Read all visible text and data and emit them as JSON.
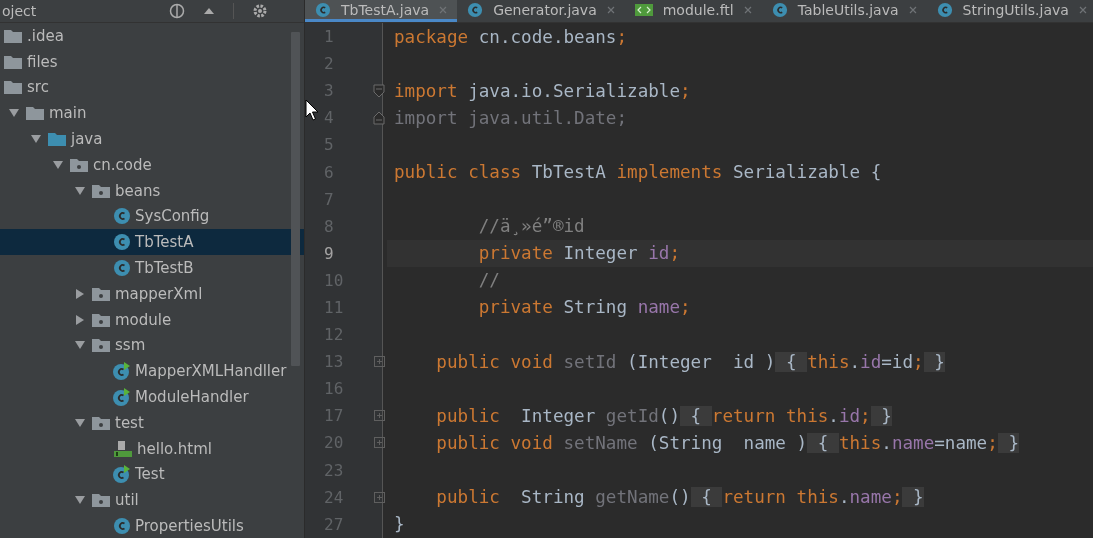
{
  "project_panel": {
    "title": "oject",
    "tree": [
      {
        "label": ".idea",
        "kind": "folder",
        "selected": false
      },
      {
        "label": "files",
        "kind": "folder",
        "selected": false
      },
      {
        "label": "src",
        "kind": "folder",
        "selected": false,
        "children": [
          {
            "label": "main",
            "kind": "folder",
            "expanded": true,
            "selected": false,
            "children": [
              {
                "label": "java",
                "kind": "source",
                "expanded": true,
                "selected": false,
                "children": [
                  {
                    "label": "cn.code",
                    "kind": "package",
                    "expanded": true,
                    "selected": false,
                    "children": [
                      {
                        "label": "beans",
                        "kind": "package",
                        "expanded": true,
                        "selected": false,
                        "children": [
                          {
                            "label": "SysConfig",
                            "kind": "class",
                            "selected": false
                          },
                          {
                            "label": "TbTestA",
                            "kind": "class",
                            "selected": true
                          },
                          {
                            "label": "TbTestB",
                            "kind": "class",
                            "selected": false
                          }
                        ]
                      },
                      {
                        "label": "mapperXml",
                        "kind": "package",
                        "expanded": false,
                        "selected": false
                      },
                      {
                        "label": "module",
                        "kind": "package",
                        "expanded": false,
                        "selected": false
                      },
                      {
                        "label": "ssm",
                        "kind": "package",
                        "expanded": true,
                        "selected": false,
                        "children": [
                          {
                            "label": "MapperXMLHandller",
                            "kind": "runnable",
                            "selected": false
                          },
                          {
                            "label": "ModuleHandler",
                            "kind": "runnable",
                            "selected": false
                          }
                        ]
                      },
                      {
                        "label": "test",
                        "kind": "package",
                        "expanded": true,
                        "selected": false,
                        "children": [
                          {
                            "label": "hello.html",
                            "kind": "html",
                            "selected": false
                          },
                          {
                            "label": "Test",
                            "kind": "runnable",
                            "selected": false
                          }
                        ]
                      },
                      {
                        "label": "util",
                        "kind": "package",
                        "expanded": true,
                        "selected": false,
                        "children": [
                          {
                            "label": "PropertiesUtils",
                            "kind": "class",
                            "selected": false
                          }
                        ]
                      }
                    ]
                  }
                ]
              }
            ]
          }
        ]
      }
    ]
  },
  "tabs": [
    {
      "label": "TbTestA.java",
      "kind": "class",
      "selected": true
    },
    {
      "label": "Generator.java",
      "kind": "class",
      "selected": false
    },
    {
      "label": "module.ftl",
      "kind": "template",
      "selected": false
    },
    {
      "label": "TableUtils.java",
      "kind": "class",
      "selected": false
    },
    {
      "label": "StringUtils.java",
      "kind": "class",
      "selected": false
    }
  ],
  "editor": {
    "lines": [
      {
        "number": "1",
        "current": false,
        "tokens": [
          {
            "text": "package ",
            "kind": "keyword"
          },
          {
            "text": "cn.code.beans",
            "kind": "plain"
          },
          {
            "text": ";",
            "kind": "keyword"
          }
        ]
      },
      {
        "number": "2",
        "current": false
      },
      {
        "number": "3",
        "current": false,
        "fold": {
          "kind": "start"
        },
        "tokens": [
          {
            "text": "import ",
            "kind": "keyword"
          },
          {
            "text": "java.io.Serializable",
            "kind": "plain"
          },
          {
            "text": ";",
            "kind": "keyword"
          }
        ]
      },
      {
        "number": "4",
        "current": false,
        "fold": {
          "kind": "end"
        },
        "tokens": [
          {
            "text": "import java.util.Date;",
            "kind": "unused"
          }
        ]
      },
      {
        "number": "5",
        "current": false
      },
      {
        "number": "6",
        "current": false,
        "tokens": [
          {
            "text": "public class ",
            "kind": "keyword"
          },
          {
            "text": "TbTestA ",
            "kind": "plain"
          },
          {
            "text": "implements ",
            "kind": "keyword"
          },
          {
            "text": "Serializable {",
            "kind": "plain"
          }
        ]
      },
      {
        "number": "7",
        "current": false
      },
      {
        "number": "8",
        "current": false,
        "tokens": [
          {
            "text": "        //ä¸»é”®id",
            "kind": "comment"
          }
        ]
      },
      {
        "number": "9",
        "current": true,
        "tokens": [
          {
            "text": "        private ",
            "kind": "keyword"
          },
          {
            "text": "Integer ",
            "kind": "plain"
          },
          {
            "text": "id",
            "kind": "field"
          },
          {
            "text": ";",
            "kind": "keyword"
          }
        ]
      },
      {
        "number": "10",
        "current": false,
        "tokens": [
          {
            "text": "        //",
            "kind": "comment"
          }
        ]
      },
      {
        "number": "11",
        "current": false,
        "tokens": [
          {
            "text": "        private ",
            "kind": "keyword"
          },
          {
            "text": "String ",
            "kind": "plain"
          },
          {
            "text": "name",
            "kind": "field"
          },
          {
            "text": ";",
            "kind": "keyword"
          }
        ]
      },
      {
        "number": "12",
        "current": false
      },
      {
        "number": "13",
        "current": false,
        "fold": {
          "kind": "collapsed"
        },
        "tokens": [
          {
            "text": "    public void ",
            "kind": "keyword"
          },
          {
            "text": "setId ",
            "kind": "unused"
          },
          {
            "text": "(Integer  id )",
            "kind": "plain"
          },
          {
            "text": " { ",
            "kind": "folded"
          },
          {
            "text": "this",
            "kind": "keyword"
          },
          {
            "text": ".",
            "kind": "plain"
          },
          {
            "text": "id",
            "kind": "field"
          },
          {
            "text": "=id",
            "kind": "plain"
          },
          {
            "text": ";",
            "kind": "keyword"
          },
          {
            "text": " }",
            "kind": "folded"
          }
        ]
      },
      {
        "number": "16",
        "current": false
      },
      {
        "number": "17",
        "current": false,
        "fold": {
          "kind": "collapsed"
        },
        "tokens": [
          {
            "text": "    public  ",
            "kind": "keyword"
          },
          {
            "text": "Integer ",
            "kind": "plain"
          },
          {
            "text": "getId",
            "kind": "unused"
          },
          {
            "text": "()",
            "kind": "plain"
          },
          {
            "text": " { ",
            "kind": "folded"
          },
          {
            "text": "return this",
            "kind": "keyword"
          },
          {
            "text": ".",
            "kind": "plain"
          },
          {
            "text": "id",
            "kind": "field"
          },
          {
            "text": ";",
            "kind": "keyword"
          },
          {
            "text": " }",
            "kind": "folded"
          }
        ]
      },
      {
        "number": "20",
        "current": false,
        "fold": {
          "kind": "collapsed"
        },
        "tokens": [
          {
            "text": "    public void ",
            "kind": "keyword"
          },
          {
            "text": "setName ",
            "kind": "unused"
          },
          {
            "text": "(String  name )",
            "kind": "plain"
          },
          {
            "text": " { ",
            "kind": "folded"
          },
          {
            "text": "this",
            "kind": "keyword"
          },
          {
            "text": ".",
            "kind": "plain"
          },
          {
            "text": "name",
            "kind": "field"
          },
          {
            "text": "=name",
            "kind": "plain"
          },
          {
            "text": ";",
            "kind": "keyword"
          },
          {
            "text": " }",
            "kind": "folded"
          }
        ]
      },
      {
        "number": "23",
        "current": false
      },
      {
        "number": "24",
        "current": false,
        "fold": {
          "kind": "collapsed"
        },
        "tokens": [
          {
            "text": "    public  ",
            "kind": "keyword"
          },
          {
            "text": "String ",
            "kind": "plain"
          },
          {
            "text": "getName",
            "kind": "unused"
          },
          {
            "text": "()",
            "kind": "plain"
          },
          {
            "text": " { ",
            "kind": "folded"
          },
          {
            "text": "return this",
            "kind": "keyword"
          },
          {
            "text": ".",
            "kind": "plain"
          },
          {
            "text": "name",
            "kind": "field"
          },
          {
            "text": ";",
            "kind": "keyword"
          },
          {
            "text": " }",
            "kind": "folded"
          }
        ]
      },
      {
        "number": "27",
        "current": false,
        "tokens": [
          {
            "text": "}",
            "kind": "plain"
          }
        ]
      }
    ]
  }
}
